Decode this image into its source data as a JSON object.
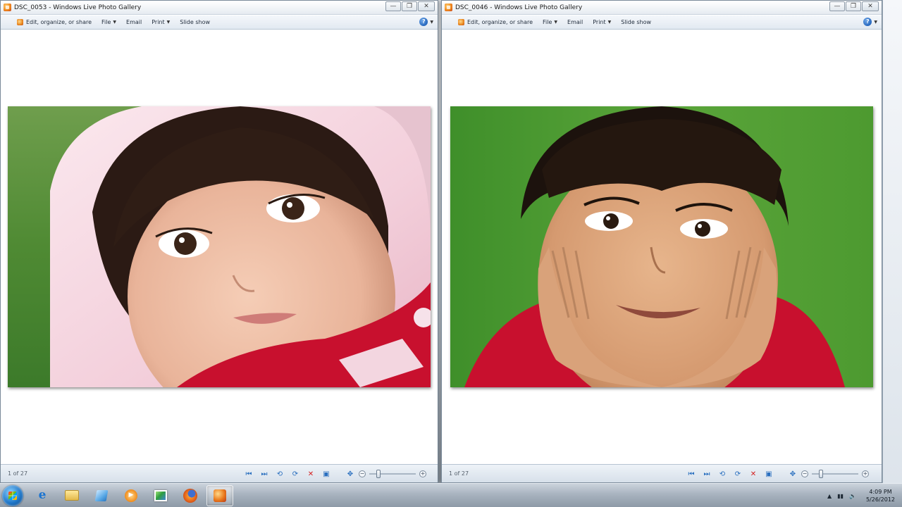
{
  "windows": [
    {
      "title": "DSC_0053 - Windows Live Photo Gallery",
      "toolbar": {
        "edit": "Edit, organize, or share",
        "file": "File",
        "email": "Email",
        "print": "Print",
        "slideshow": "Slide show"
      },
      "status": {
        "page": "1 of 27"
      },
      "photo": "photo-baby-in-pink-hood"
    },
    {
      "title": "DSC_0046 - Windows Live Photo Gallery",
      "toolbar": {
        "edit": "Edit, organize, or share",
        "file": "File",
        "email": "Email",
        "print": "Print",
        "slideshow": "Slide show"
      },
      "status": {
        "page": "1 of 27"
      },
      "photo": "photo-boy-hands-on-cheeks"
    }
  ],
  "taskbar": {
    "apps": [
      "start",
      "internet-explorer",
      "windows-explorer",
      "windows-live-tiles",
      "media-player",
      "photo-gallery",
      "firefox",
      "live-photo-gallery"
    ],
    "active_app": "live-photo-gallery"
  },
  "clock": {
    "time": "4:09 PM",
    "date": "5/26/2012"
  },
  "colors": {
    "accent_blue": "#2a6fbf",
    "delete_red": "#d42020",
    "grass_green": "#4f9a34",
    "shirt_red": "#c8102e"
  }
}
